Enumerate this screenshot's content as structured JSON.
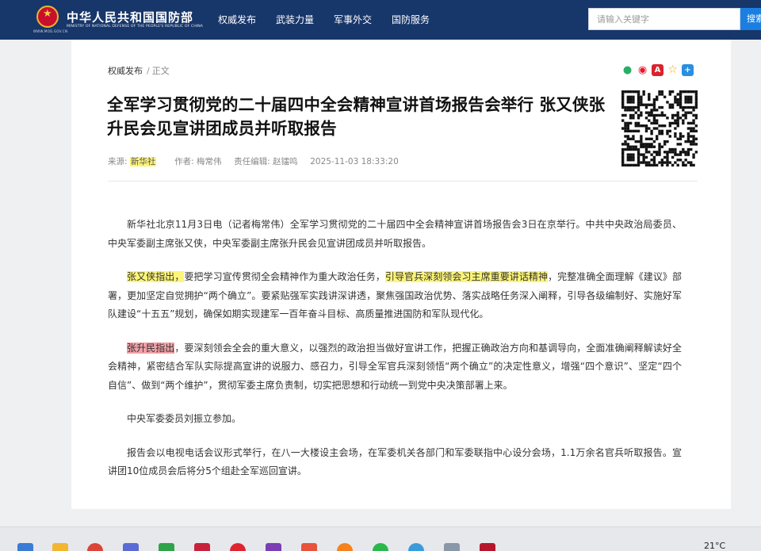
{
  "header": {
    "site_title": "中华人民共和国国防部",
    "site_subtitle": "MINISTRY OF NATIONAL DEFENSE OF THE PEOPLE'S REPUBLIC OF CHINA",
    "domain": "WWW.MOD.GOV.CN",
    "nav": [
      "权威发布",
      "武装力量",
      "军事外交",
      "国防服务"
    ],
    "search_placeholder": "请输入关键字",
    "search_button": "搜索",
    "colors": {
      "bar": "#17366a",
      "search_button": "#1b7ee0"
    }
  },
  "breadcrumb": {
    "parent": "权威发布",
    "separator": "/",
    "current": "正文"
  },
  "share_icons": [
    "wechat-icon",
    "weibo-icon",
    "pdf-icon",
    "favorite-star-icon",
    "add-icon"
  ],
  "article": {
    "title": "全军学习贯彻党的二十届四中全会精神宣讲首场报告会举行 张又侠张升民会见宣讲团成员并听取报告",
    "meta": {
      "source_label": "来源:",
      "source": "新华社",
      "author_label": "作者:",
      "author": "梅常伟",
      "editor_label": "责任编辑:",
      "editor": "赵镭鸣",
      "datetime": "2025-11-03 18:33:20"
    },
    "p1": "新华社北京11月3日电（记者梅常伟）全军学习贯彻党的二十届四中全会精神宣讲首场报告会3日在京举行。中共中央政治局委员、中央军委副主席张又侠，中央军委副主席张升民会见宣讲团成员并听取报告。",
    "p2_a": "张又侠指出，",
    "p2_b": "要把学习宣传贯彻全会精神作为重大政治任务，",
    "p2_c": "引导官兵深刻领会习主席重要讲话精神",
    "p2_d": "，完整准确全面理解《建议》部署，更加坚定自觉拥护“两个确立”。要紧贴强军实践讲深讲透，聚焦强国政治优势、落实战略任务深入阐释，引导各级编制好、实施好军队建设“十五五”规划，确保如期实现建军一百年奋斗目标、高质量推进国防和军队现代化。",
    "p3_a": "张升民指出",
    "p3_b": "，要深刻领会全会的重大意义，以强烈的政治担当做好宣讲工作，把握正确政治方向和基调导向，全面准确阐释解读好全会精神，紧密结合军队实际提高宣讲的说服力、感召力，引导全军官兵深刻领悟“两个确立”的决定性意义，增强“四个意识”、坚定“四个自信”、做到“两个维护”，贯彻军委主席负责制，切实把思想和行动统一到党中央决策部署上来。",
    "p4": "中央军委委员刘振立参加。",
    "p5": "报告会以电视电话会议形式举行，在八一大楼设主会场，在军委机关各部门和军委联指中心设分会场，1.1万余名官兵听取报告。宣讲团10位成员会后将分5个组赴全军巡回宣讲。",
    "highlight_colors": {
      "yellow": "#fdf57a",
      "red": "#f2a0a6"
    }
  },
  "taskbar": {
    "temperature": "21°C",
    "icons": [
      "windows-start-icon",
      "file-explorer-icon",
      "chrome-icon",
      "app-icon",
      "app-icon",
      "app-icon",
      "opera-icon",
      "onenote-icon",
      "app-icon",
      "firefox-icon",
      "wechat-icon",
      "app-icon",
      "folder-icon",
      "app-icon"
    ]
  }
}
